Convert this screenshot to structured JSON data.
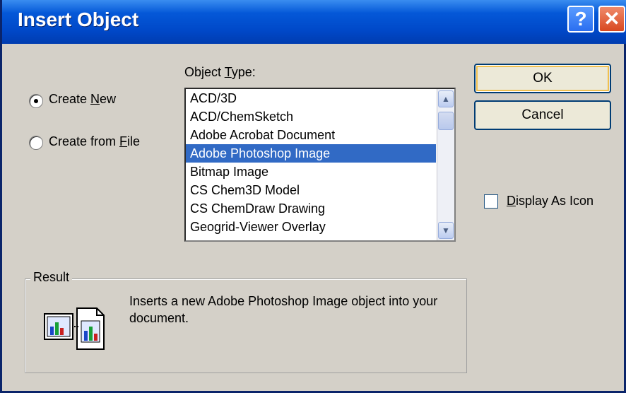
{
  "window": {
    "title": "Insert Object",
    "help_glyph": "?",
    "close_glyph": "✕"
  },
  "options": {
    "create_new": {
      "prefix": "Create ",
      "accel": "N",
      "suffix": "ew",
      "selected": true
    },
    "create_from_file": {
      "prefix": "Create from ",
      "accel": "F",
      "suffix": "ile",
      "selected": false
    }
  },
  "object_type": {
    "label_prefix": "Object ",
    "label_accel": "T",
    "label_suffix": "ype:",
    "items": [
      "ACD/3D",
      "ACD/ChemSketch",
      "Adobe Acrobat Document",
      "Adobe Photoshop Image",
      "Bitmap Image",
      "CS Chem3D Model",
      "CS ChemDraw Drawing",
      "Geogrid-Viewer Overlay"
    ],
    "selected_index": 3
  },
  "buttons": {
    "ok": "OK",
    "cancel": "Cancel"
  },
  "display_as_icon": {
    "accel": "D",
    "rest": "isplay As Icon",
    "checked": false
  },
  "result": {
    "label": "Result",
    "text": "Inserts a new Adobe Photoshop Image object into your document."
  },
  "colors": {
    "title_bar": "#0054e3",
    "selection": "#316ac5",
    "dialog_bg": "#d4d0c8"
  }
}
